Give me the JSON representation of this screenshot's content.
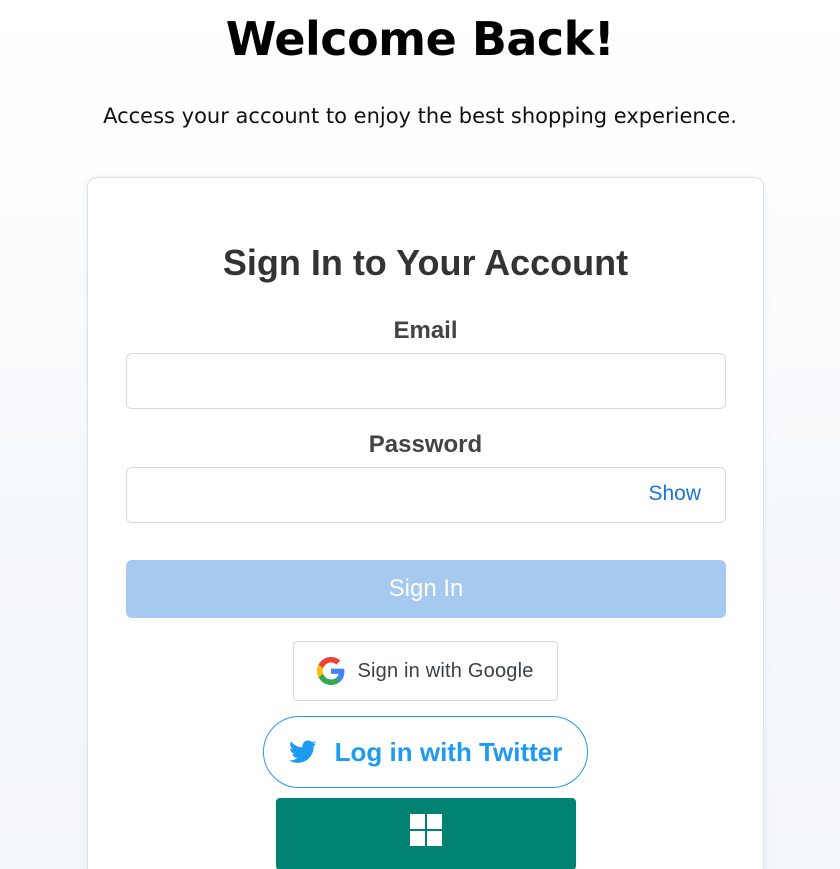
{
  "hero": {
    "title": "Welcome Back!",
    "subtitle": "Access your account to enjoy the best shopping experience."
  },
  "form": {
    "title": "Sign In to Your Account",
    "email_label": "Email",
    "email_value": "",
    "password_label": "Password",
    "password_value": "",
    "show_toggle": "Show",
    "submit_label": "Sign In"
  },
  "social": {
    "google_label": "Sign in with Google",
    "twitter_label": "Log in with Twitter",
    "google_icon": "google-g-icon",
    "twitter_icon": "twitter-bird-icon",
    "microsoft_icon": "windows-logo-icon"
  },
  "colors": {
    "submit_bg": "#a6c9f0",
    "link": "#1877d2",
    "twitter": "#1d9bf0",
    "microsoft_bg": "#008272"
  }
}
